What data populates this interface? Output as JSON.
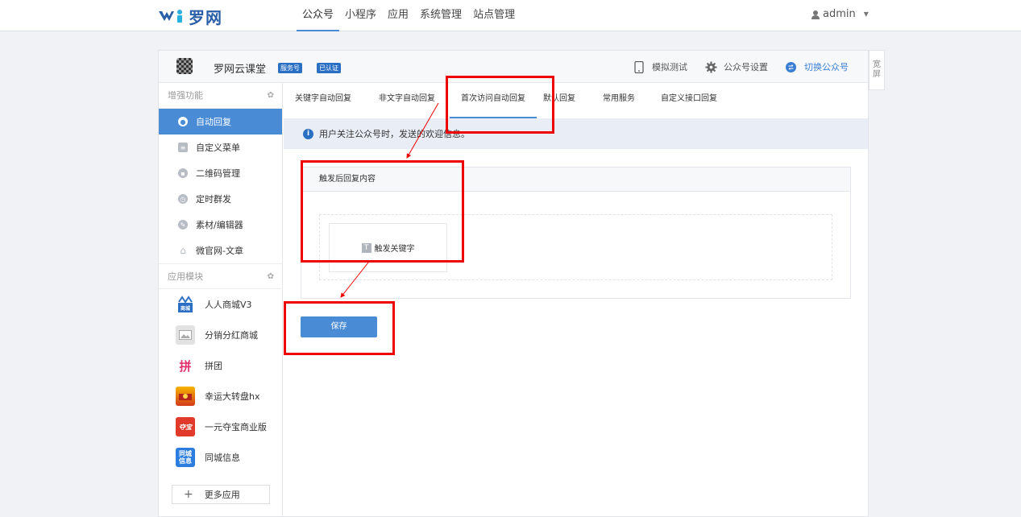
{
  "header": {
    "logo_text": "罗网",
    "nav": [
      "公众号",
      "小程序",
      "应用",
      "系统管理",
      "站点管理"
    ],
    "user": "admin"
  },
  "account": {
    "name": "罗网云课堂",
    "badge_service": "服务号",
    "badge_verified": "已认证",
    "actions": {
      "simulate": "模拟测试",
      "settings": "公众号设置",
      "switch": "切换公众号"
    }
  },
  "wide_toggle": "宽屏",
  "sidebar": {
    "section1": "增强功能",
    "items": [
      {
        "label": "自动回复",
        "icon": "chat-icon"
      },
      {
        "label": "自定义菜单",
        "icon": "menu-edit-icon"
      },
      {
        "label": "二维码管理",
        "icon": "qrcode-icon"
      },
      {
        "label": "定时群发",
        "icon": "clock-icon"
      },
      {
        "label": "素材/编辑器",
        "icon": "pencil-icon"
      },
      {
        "label": "微官网-文章",
        "icon": "home-icon"
      }
    ],
    "section2": "应用模块",
    "apps": [
      {
        "label": "人人商城V3",
        "icon_text": "商城",
        "color": "#2b6fc4"
      },
      {
        "label": "分销分红商城",
        "icon_text": "",
        "color": "#d8d8d8"
      },
      {
        "label": "拼团",
        "icon_text": "拼",
        "color": "#ffffff"
      },
      {
        "label": "幸运大转盘hx",
        "icon_text": "",
        "color": "#f0a000"
      },
      {
        "label": "一元夺宝商业版",
        "icon_text": "",
        "color": "#e23a2a"
      },
      {
        "label": "同城信息",
        "icon_text": "同城信息",
        "color": "#2b7de0"
      }
    ],
    "more": "更多应用"
  },
  "tabs": [
    "关键字自动回复",
    "非文字自动回复",
    "首次访问自动回复",
    "默认回复",
    "常用服务",
    "自定义接口回复"
  ],
  "info": "用户关注公众号时，发送的欢迎信息。",
  "reply": {
    "header": "触发后回复内容",
    "keyword_card": "触发关键字"
  },
  "save_label": "保存",
  "colors": {
    "accent": "#4a8bd6",
    "annotation": "#ee0000",
    "info_bg": "#e9edf6"
  }
}
